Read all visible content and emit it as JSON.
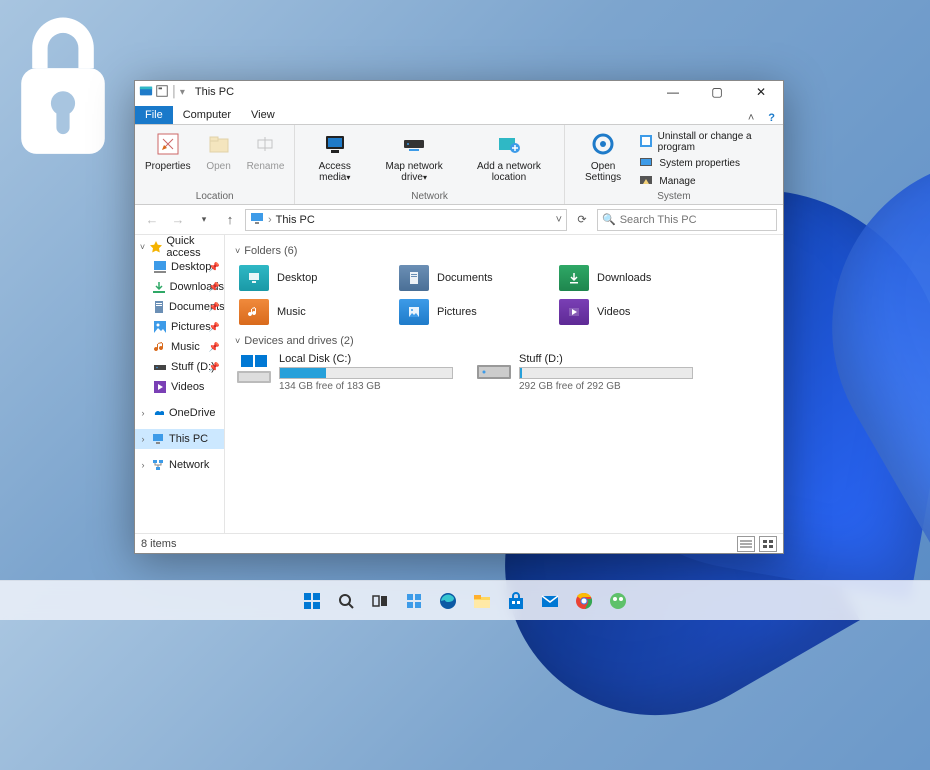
{
  "window": {
    "title": "This PC",
    "tabs": {
      "file": "File",
      "computer": "Computer",
      "view": "View"
    }
  },
  "ribbon": {
    "location": {
      "label": "Location",
      "properties": "Properties",
      "open": "Open",
      "rename": "Rename"
    },
    "network": {
      "label": "Network",
      "access_media": "Access media",
      "map_drive": "Map network drive",
      "add_location": "Add a network location"
    },
    "system": {
      "label": "System",
      "open_settings": "Open Settings",
      "uninstall": "Uninstall or change a program",
      "system_properties": "System properties",
      "manage": "Manage"
    }
  },
  "nav": {
    "breadcrumb": "This PC",
    "search_placeholder": "Search This PC"
  },
  "sidebar": {
    "quick_access": "Quick access",
    "items": [
      {
        "label": "Desktop"
      },
      {
        "label": "Downloads"
      },
      {
        "label": "Documents"
      },
      {
        "label": "Pictures"
      },
      {
        "label": "Music"
      },
      {
        "label": "Stuff (D:)"
      },
      {
        "label": "Videos"
      }
    ],
    "onedrive": "OneDrive",
    "this_pc": "This PC",
    "network": "Network"
  },
  "content": {
    "folders_header": "Folders (6)",
    "drives_header": "Devices and drives (2)",
    "folders": [
      {
        "label": "Desktop"
      },
      {
        "label": "Documents"
      },
      {
        "label": "Downloads"
      },
      {
        "label": "Music"
      },
      {
        "label": "Pictures"
      },
      {
        "label": "Videos"
      }
    ],
    "drives": [
      {
        "label": "Local Disk (C:)",
        "free": "134 GB free of 183 GB",
        "fill_pct": 27
      },
      {
        "label": "Stuff (D:)",
        "free": "292 GB free of 292 GB",
        "fill_pct": 1
      }
    ]
  },
  "status": {
    "items": "8 items"
  },
  "taskbar": {
    "icons": [
      "start",
      "search",
      "taskview",
      "widgets",
      "edge",
      "explorer",
      "store",
      "mail",
      "chrome",
      "app"
    ]
  }
}
